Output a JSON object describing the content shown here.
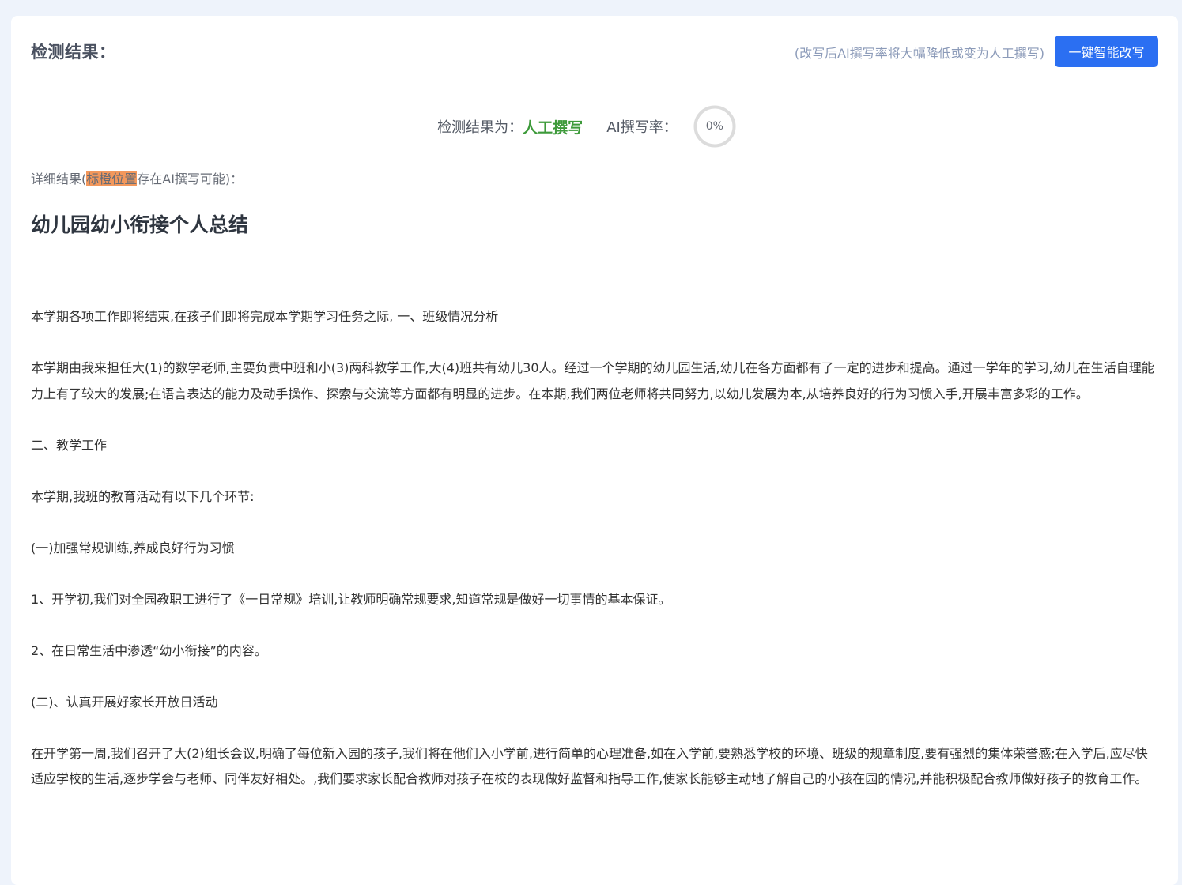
{
  "header": {
    "title": "检测结果：",
    "hint": "(改写后AI撰写率将大幅降低或变为人工撰写)",
    "rewrite_button": "一键智能改写"
  },
  "summary": {
    "result_label": "检测结果为：",
    "result_value": "人工撰写",
    "rate_label": "AI撰写率：",
    "rate_value": "0%",
    "rate_fraction": 0,
    "result_color": "#3d9a3a"
  },
  "detail": {
    "prefix": "详细结果(",
    "highlight": "标橙位置",
    "suffix": "存在AI撰写可能)：",
    "highlight_color": "#f3985c"
  },
  "document": {
    "title": "幼儿园幼小衔接个人总结",
    "paragraphs": [
      "本学期各项工作即将结束,在孩子们即将完成本学期学习任务之际, 一、班级情况分析",
      "本学期由我来担任大(1)的数学老师,主要负责中班和小(3)两科教学工作,大(4)班共有幼儿30人。经过一个学期的幼儿园生活,幼儿在各方面都有了一定的进步和提高。通过一学年的学习,幼儿在生活自理能力上有了较大的发展;在语言表达的能力及动手操作、探索与交流等方面都有明显的进步。在本期,我们两位老师将共同努力,以幼儿发展为本,从培养良好的行为习惯入手,开展丰富多彩的工作。",
      "二、教学工作",
      "本学期,我班的教育活动有以下几个环节:",
      "(一)加强常规训练,养成良好行为习惯",
      "1、开学初,我们对全园教职工进行了《一日常规》培训,让教师明确常规要求,知道常规是做好一切事情的基本保证。",
      "2、在日常生活中渗透“幼小衔接”的内容。",
      "(二)、认真开展好家长开放日活动",
      "在开学第一周,我们召开了大(2)组长会议,明确了每位新入园的孩子,我们将在他们入小学前,进行简单的心理准备,如在入学前,要熟悉学校的环境、班级的规章制度,要有强烈的集体荣誉感;在入学后,应尽快适应学校的生活,逐步学会与老师、同伴友好相处。,我们要求家长配合教师对孩子在校的表现做好监督和指导工作,使家长能够主动地了解自己的小孩在园的情况,并能积极配合教师做好孩子的教育工作。"
    ]
  }
}
